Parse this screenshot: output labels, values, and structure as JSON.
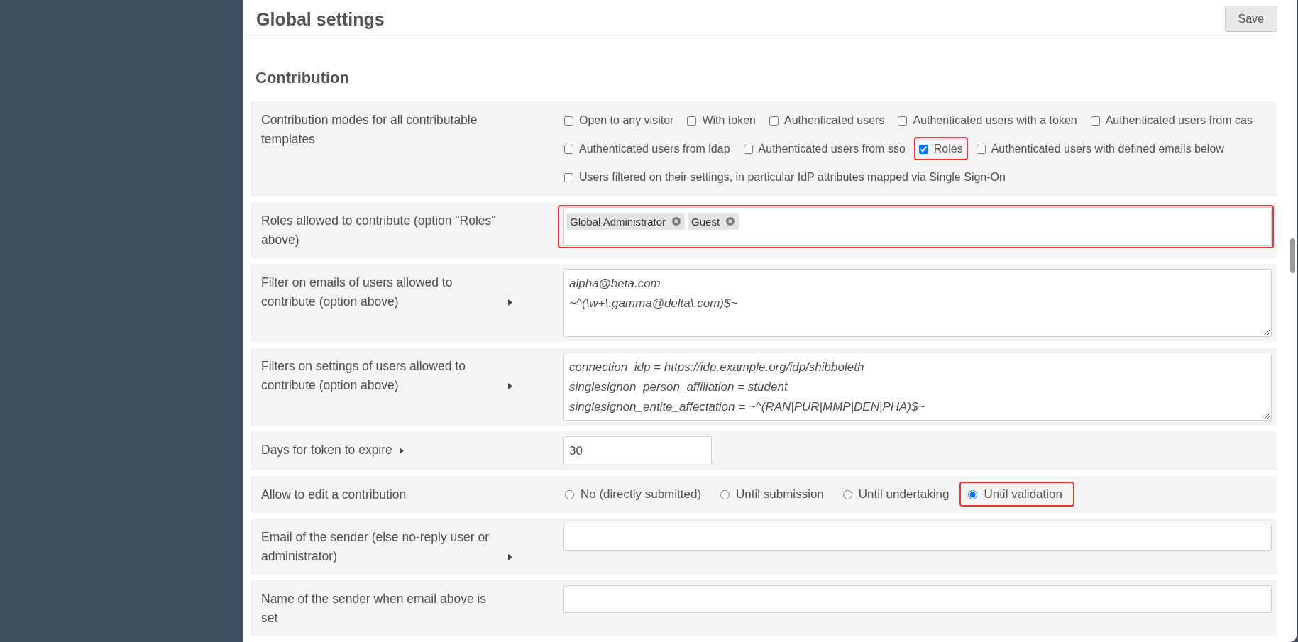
{
  "header": {
    "title": "Global settings",
    "save_button": "Save"
  },
  "section": {
    "title": "Contribution",
    "rows": [
      {
        "kind": "checkboxes",
        "label": "Contribution modes for all contributable templates",
        "expandable": false,
        "highlighted": false,
        "options": [
          {
            "label": "Open to any visitor",
            "checked": false,
            "highlighted": false
          },
          {
            "label": "With token",
            "checked": false,
            "highlighted": false
          },
          {
            "label": "Authenticated users",
            "checked": false,
            "highlighted": false
          },
          {
            "label": "Authenticated users with a token",
            "checked": false,
            "highlighted": false
          },
          {
            "label": "Authenticated users from cas",
            "checked": false,
            "highlighted": false
          },
          {
            "label": "Authenticated users from ldap",
            "checked": false,
            "highlighted": false
          },
          {
            "label": "Authenticated users from sso",
            "checked": false,
            "highlighted": false
          },
          {
            "label": "Roles",
            "checked": true,
            "highlighted": true
          },
          {
            "label": "Authenticated users with defined emails below",
            "checked": false,
            "highlighted": false
          },
          {
            "label": "Users filtered on their settings, in particular IdP attributes mapped via Single Sign-On",
            "checked": false,
            "highlighted": false
          }
        ]
      },
      {
        "kind": "tags",
        "label": "Roles allowed to contribute (option \"Roles\" above)",
        "expandable": false,
        "highlighted": true,
        "tags": [
          "Global Administrator",
          "Guest"
        ]
      },
      {
        "kind": "textarea",
        "label": "Filter on emails of users allowed to contribute (option above)",
        "expandable": true,
        "highlighted": false,
        "lines": [
          "alpha@beta.com",
          "~^(\\w+\\.gamma@delta\\.com)$~"
        ]
      },
      {
        "kind": "textarea",
        "label": "Filters on settings of users allowed to contribute (option above)",
        "expandable": true,
        "highlighted": false,
        "lines": [
          "connection_idp = https://idp.example.org/idp/shibboleth",
          "singlesignon_person_affiliation = student",
          "singlesignon_entite_affectation = ~^(RAN|PUR|MMP|DEN|PHA)$~"
        ]
      },
      {
        "kind": "number",
        "label": "Days for token to expire",
        "expandable": true,
        "highlighted": false,
        "value": "30"
      },
      {
        "kind": "radios",
        "label": "Allow to edit a contribution",
        "expandable": false,
        "highlighted": false,
        "options": [
          {
            "label": "No (directly submitted)",
            "selected": false,
            "highlighted": false
          },
          {
            "label": "Until submission",
            "selected": false,
            "highlighted": false
          },
          {
            "label": "Until undertaking",
            "selected": false,
            "highlighted": false
          },
          {
            "label": "Until validation",
            "selected": true,
            "highlighted": true
          }
        ]
      },
      {
        "kind": "text",
        "label": "Email of the sender (else no-reply user or administrator)",
        "expandable": true,
        "highlighted": false
      },
      {
        "kind": "text",
        "label": "Name of the sender when email above is set",
        "expandable": false,
        "highlighted": false
      }
    ]
  }
}
